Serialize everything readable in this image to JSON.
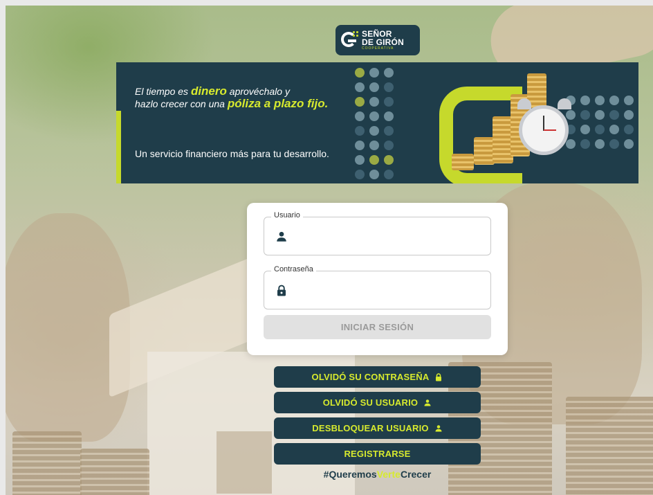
{
  "brand": {
    "name_line1": "SEÑOR",
    "name_line2": "DE GIRÓN",
    "name_line3": "COOPERATIVA"
  },
  "banner": {
    "line1_pre": "El tiempo es ",
    "line1_highlight": "dinero",
    "line1_post": " aprovéchalo y",
    "line2_pre": "hazlo crecer con una ",
    "line2_highlight": "póliza a plazo fijo.",
    "tagline": "Un servicio financiero más para tu desarrollo."
  },
  "login": {
    "username_label": "Usuario",
    "username_value": "",
    "password_label": "Contraseña",
    "password_value": "",
    "submit_label": "INICIAR SESIÓN"
  },
  "actions": {
    "forgot_password": "OLVIDÓ SU CONTRASEÑA",
    "forgot_user": "OLVIDÓ SU USUARIO",
    "unlock_user": "DESBLOQUEAR USUARIO",
    "register": "REGISTRARSE"
  },
  "hashtag": {
    "part1": "#Queremos",
    "part2": "Verte",
    "part3": "Crecer"
  },
  "colors": {
    "brand_dark": "#1f3d4a",
    "brand_accent": "#c6d92c"
  }
}
